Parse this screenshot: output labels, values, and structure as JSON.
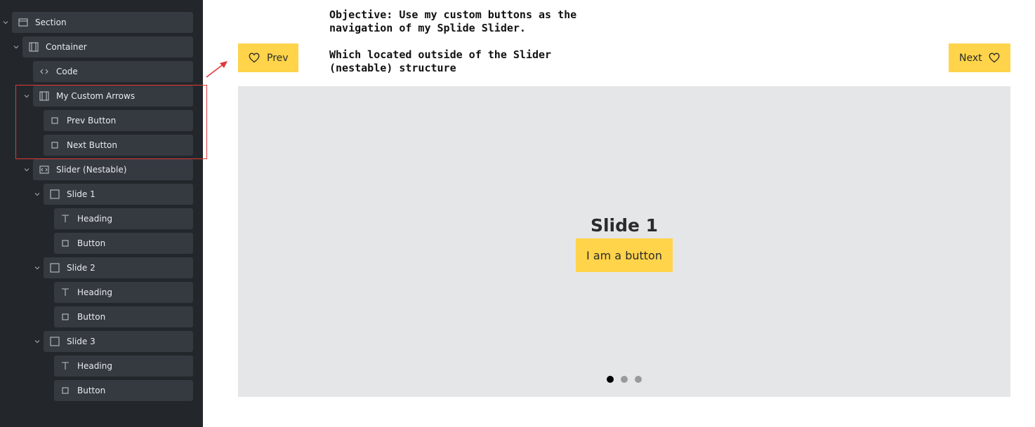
{
  "structure_panel": {
    "items": [
      {
        "label": "Section",
        "icon": "section-icon"
      },
      {
        "label": "Container",
        "icon": "container-icon"
      },
      {
        "label": "Code",
        "icon": "code-icon"
      },
      {
        "label": "My Custom Arrows",
        "icon": "container-icon"
      },
      {
        "label": "Prev Button",
        "icon": "div-icon"
      },
      {
        "label": "Next Button",
        "icon": "div-icon"
      },
      {
        "label": "Slider (Nestable)",
        "icon": "slider-icon"
      },
      {
        "label": "Slide 1",
        "icon": "block-icon"
      },
      {
        "label": "Heading",
        "icon": "heading-icon"
      },
      {
        "label": "Button",
        "icon": "button-icon"
      },
      {
        "label": "Slide 2",
        "icon": "block-icon"
      },
      {
        "label": "Heading",
        "icon": "heading-icon"
      },
      {
        "label": "Button",
        "icon": "button-icon"
      },
      {
        "label": "Slide 3",
        "icon": "block-icon"
      },
      {
        "label": "Heading",
        "icon": "heading-icon"
      },
      {
        "label": "Button",
        "icon": "button-icon"
      }
    ]
  },
  "canvas": {
    "prev_label": "Prev",
    "next_label": "Next",
    "nav_icon": "heart-icon",
    "note_objective": "Objective: Use my custom buttons as the navigation of my Splide Slider.",
    "note_location": "Which located outside of the Slider (nestable) structure",
    "slide": {
      "heading": "Slide 1",
      "button_label": "I am a button"
    },
    "pagination": {
      "count": 3,
      "active_index": 0
    }
  },
  "colors": {
    "panel_bg": "#23272b",
    "row_bg": "#353a40",
    "accent_yellow": "#ffd44a",
    "highlight_red": "#e0383a",
    "slider_bg": "#e5e6e8"
  }
}
